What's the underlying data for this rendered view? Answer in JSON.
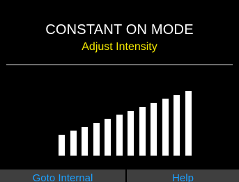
{
  "header": {
    "title": "CONSTANT ON MODE",
    "subtitle": "Adjust Intensity"
  },
  "intensity": {
    "levels_total": 12,
    "levels_active": 12
  },
  "softkeys": {
    "left_label": "Goto Internal",
    "right_label": "Help"
  },
  "colors": {
    "background": "#000000",
    "title": "#ffffff",
    "subtitle": "#f2e600",
    "bar": "#ffffff",
    "softkey_text": "#1da1ff",
    "softkey_bg": "#3f3f3f"
  }
}
